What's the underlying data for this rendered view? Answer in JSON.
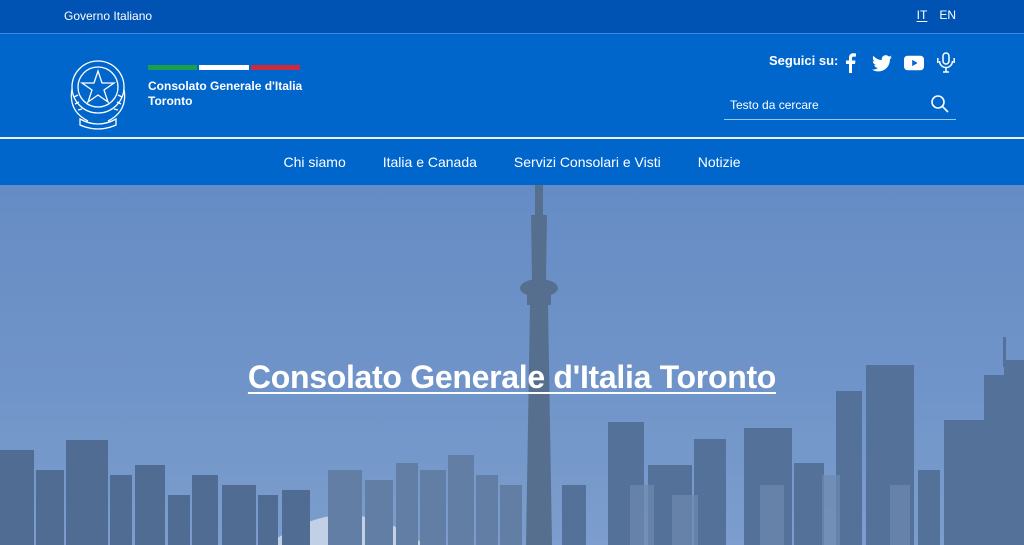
{
  "topbar": {
    "government_label": "Governo Italiano",
    "languages": [
      {
        "code": "IT",
        "active": true
      },
      {
        "code": "EN",
        "active": false
      }
    ]
  },
  "header": {
    "brand_line1": "Consolato Generale d'Italia",
    "brand_line2": "Toronto",
    "follow_label": "Seguici su:",
    "socials": [
      "facebook-icon",
      "twitter-icon",
      "youtube-icon",
      "podcast-icon"
    ],
    "search_placeholder": "Testo da cercare",
    "flag_colors": [
      "#1c9e4b",
      "#ffffff",
      "#cd2a3b"
    ]
  },
  "nav": {
    "items": [
      {
        "label": "Chi siamo"
      },
      {
        "label": "Italia e Canada"
      },
      {
        "label": "Servizi Consolari e Visti"
      },
      {
        "label": "Notizie"
      }
    ]
  },
  "hero": {
    "title": "Consolato Generale d'Italia Toronto"
  },
  "colors": {
    "primary": "#0066cc",
    "topbar": "#0052b3"
  }
}
